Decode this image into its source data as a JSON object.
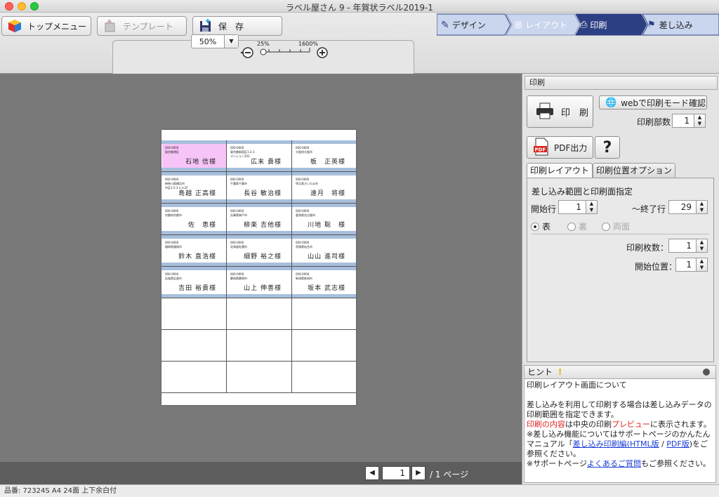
{
  "window": {
    "title": "ラベル屋さん 9 - 年賀状ラベル2019-1"
  },
  "toolbar": {
    "top_menu": "トップメニュー",
    "template": "テンプレート",
    "save": "保　存",
    "zoom_value": "50%",
    "zoom_min_label": "25%",
    "zoom_max_label": "1600%"
  },
  "steps": [
    {
      "label": "デザイン",
      "state": "normal"
    },
    {
      "label": "レイアウト",
      "state": "disabled"
    },
    {
      "label": "印刷",
      "state": "active"
    },
    {
      "label": "差し込み",
      "state": "normal"
    }
  ],
  "labels": [
    {
      "zip": "000-0000",
      "addr1": "東京都港区",
      "addr2": "",
      "name": "石地 信様",
      "highlight": true
    },
    {
      "zip": "000-0000",
      "addr1": "東京都新宿区1-2-3",
      "addr2": "マンション101",
      "name": "広末 貴様"
    },
    {
      "zip": "000-0000",
      "addr1": "大阪府大阪市",
      "addr2": "",
      "name": "板　正英様"
    },
    {
      "zip": "000-0000",
      "addr1": "神奈川県横浜市",
      "addr2": "中区1-2-3 ビル2F",
      "name": "島越 正高様"
    },
    {
      "zip": "000-0000",
      "addr1": "千葉県千葉市",
      "addr2": "",
      "name": "長谷 敏治様"
    },
    {
      "zip": "000-0000",
      "addr1": "埼玉県さいたま市",
      "addr2": "",
      "name": "遠月　将様"
    },
    {
      "zip": "000-0000",
      "addr1": "京都府京都市",
      "addr2": "",
      "name": "佐　恵様"
    },
    {
      "zip": "000-0000",
      "addr1": "兵庫県神戸市",
      "addr2": "",
      "name": "柳楽 吉他様"
    },
    {
      "zip": "000-0000",
      "addr1": "愛知県名古屋市",
      "addr2": "",
      "name": "川地 聡　様"
    },
    {
      "zip": "000-0000",
      "addr1": "福岡県福岡市",
      "addr2": "",
      "name": "鈴木 直浩様"
    },
    {
      "zip": "000-0000",
      "addr1": "北海道札幌市",
      "addr2": "",
      "name": "細野 裕之様"
    },
    {
      "zip": "000-0000",
      "addr1": "宮城県仙台市",
      "addr2": "",
      "name": "山山 進司様"
    },
    {
      "zip": "000-0000",
      "addr1": "広島県広島市",
      "addr2": "",
      "name": "吉田 裕貴様"
    },
    {
      "zip": "000-0000",
      "addr1": "静岡県静岡市",
      "addr2": "",
      "name": "山上 伸善様"
    },
    {
      "zip": "000-0000",
      "addr1": "新潟県新潟市",
      "addr2": "",
      "name": "坂本 武志様"
    }
  ],
  "pager": {
    "current": "1",
    "total": "/ 1 ページ"
  },
  "status": "品番: 72324S A4 24面 上下余白付",
  "panel": {
    "header": "印刷",
    "print_button": "印　刷",
    "web_button": "webで印刷モード確認",
    "copies_label": "印刷部数",
    "copies_value": "1",
    "pdf_button": "PDF出力",
    "help_button": "?",
    "tabs": [
      {
        "label": "印刷レイアウト",
        "active": true
      },
      {
        "label": "印刷位置オプション",
        "active": false
      }
    ],
    "section_title": "差し込み範囲と印刷面指定",
    "start_row_label": "開始行",
    "start_row_value": "1",
    "end_row_label": "〜終了行",
    "end_row_value": "29",
    "radio_front": "表",
    "radio_back": "裏",
    "radio_both": "両面",
    "sheets_label": "印刷枚数：",
    "sheets_value": "1",
    "start_pos_label": "開始位置：",
    "start_pos_value": "1"
  },
  "hint": {
    "title": "ヒント",
    "line1": "印刷レイアウト画面について",
    "line2": "差し込みを利用して印刷する場合は差し込みデータの印刷範囲を指定できます。",
    "line3a": "印刷の内容",
    "line3b": "は中央の印刷",
    "line3c": "プレビュー",
    "line3d": "に表示されます。",
    "line4": "※差し込み機能についてはサポートページのかんたんマニュアル「",
    "link1": "差し込み印刷編(HTML版",
    "sep": " / ",
    "link2": "PDF版",
    "line4end": ")をご参照ください。",
    "line5": "※サポートページ",
    "link3": "よくあるご質問",
    "line5end": "もご参照ください。"
  },
  "colors": {
    "label_band": "#a7bfdc",
    "highlight": "#f6c4f6",
    "active_step": "#2d3f83",
    "step_bg": "#c9d6ee"
  }
}
